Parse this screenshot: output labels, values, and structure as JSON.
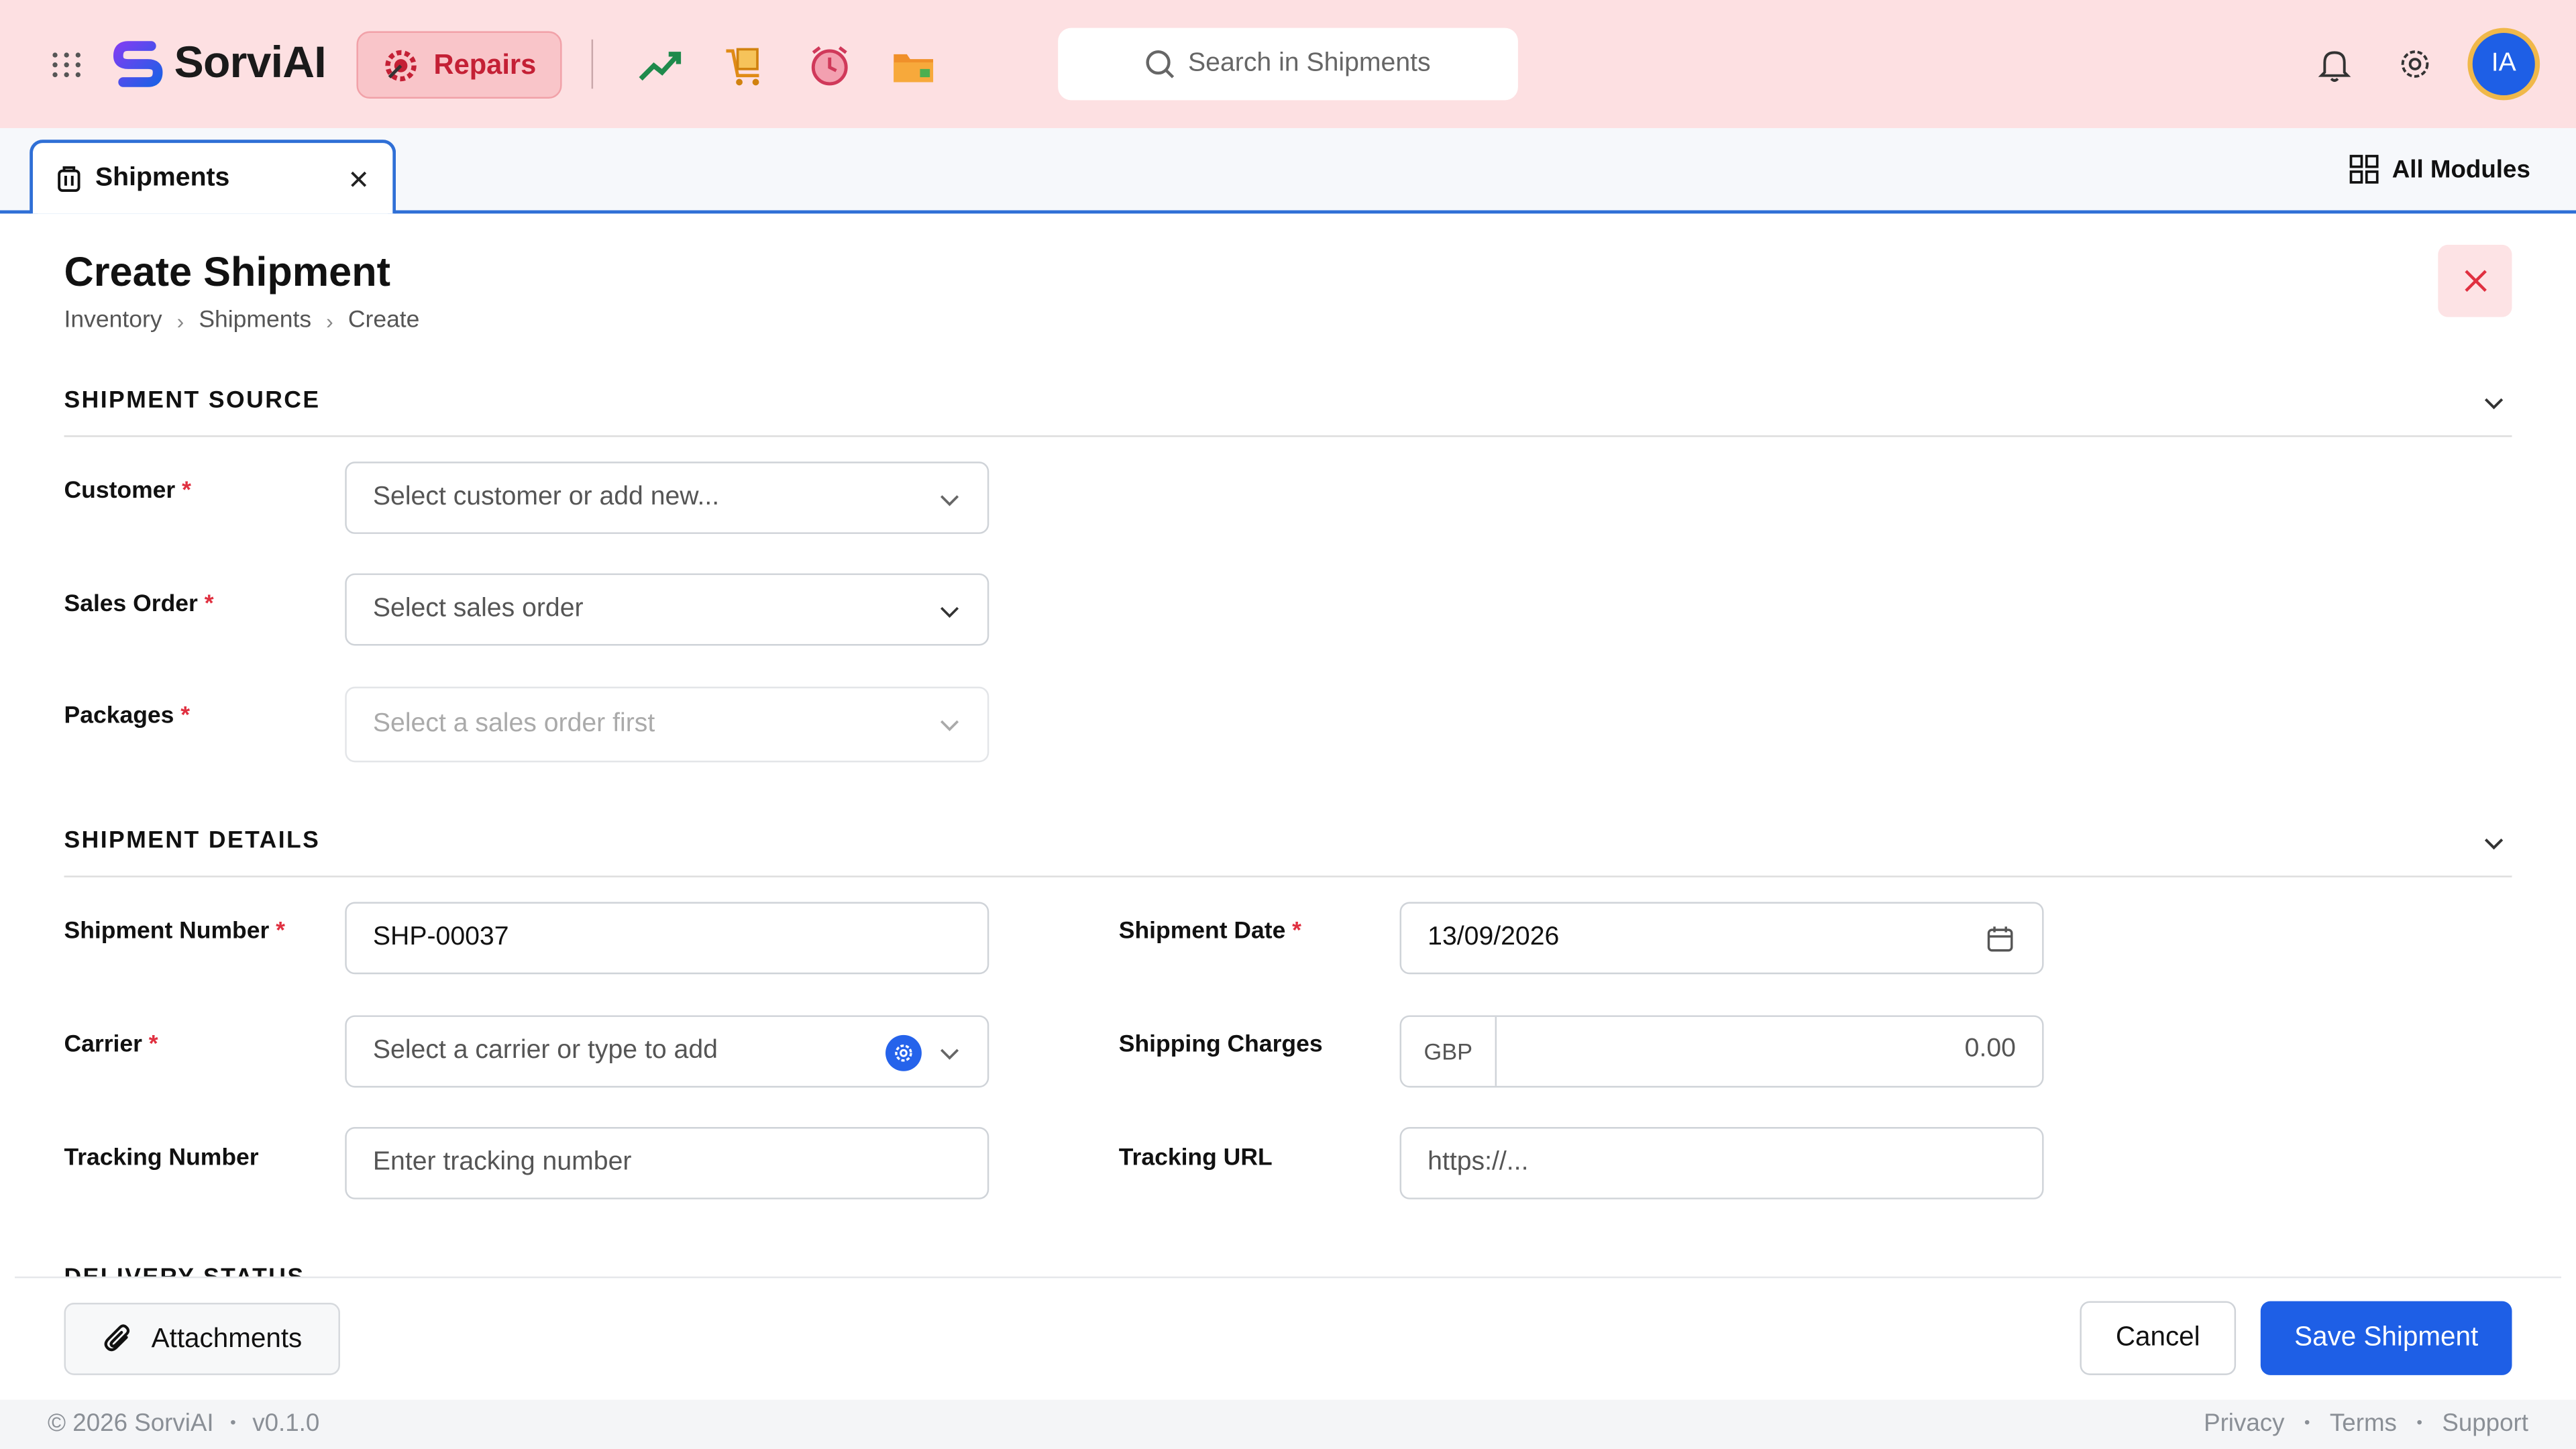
{
  "app": {
    "name": "SorviAI"
  },
  "top": {
    "module_label": "Repairs",
    "search_placeholder": "Search in Shipments",
    "avatar_initials": "IA",
    "quick_icons": [
      "trending-up-icon",
      "box-cart-icon",
      "alarm-icon",
      "folder-icon"
    ]
  },
  "tabs": {
    "active_label": "Shipments",
    "all_modules_label": "All Modules"
  },
  "page": {
    "title": "Create Shipment",
    "breadcrumb": [
      "Inventory",
      "Shipments",
      "Create"
    ]
  },
  "sections": {
    "source": {
      "title": "SHIPMENT SOURCE",
      "customer": {
        "label": "Customer",
        "placeholder": "Select customer or add new..."
      },
      "sales_order": {
        "label": "Sales Order",
        "placeholder": "Select sales order"
      },
      "packages": {
        "label": "Packages",
        "placeholder": "Select a sales order first"
      }
    },
    "details": {
      "title": "SHIPMENT DETAILS",
      "shipment_number": {
        "label": "Shipment Number",
        "value": "SHP-00037"
      },
      "shipment_date": {
        "label": "Shipment Date",
        "value": "13/09/2026"
      },
      "carrier": {
        "label": "Carrier",
        "placeholder": "Select a carrier or type to add"
      },
      "shipping_charges": {
        "label": "Shipping Charges",
        "currency": "GBP",
        "value": "0.00"
      },
      "tracking_number": {
        "label": "Tracking Number",
        "placeholder": "Enter tracking number"
      },
      "tracking_url": {
        "label": "Tracking URL",
        "placeholder": "https://..."
      }
    },
    "delivery": {
      "title": "DELIVERY STATUS"
    }
  },
  "footer": {
    "attachments_label": "Attachments",
    "cancel_label": "Cancel",
    "save_label": "Save Shipment"
  },
  "status_bar": {
    "copyright": "© 2026 SorviAI",
    "version": "v0.1.0",
    "links": [
      "Privacy",
      "Terms",
      "Support"
    ]
  },
  "colors": {
    "primary": "#1e5fe6",
    "topbar": "#fde0e2",
    "required": "#e03040"
  }
}
